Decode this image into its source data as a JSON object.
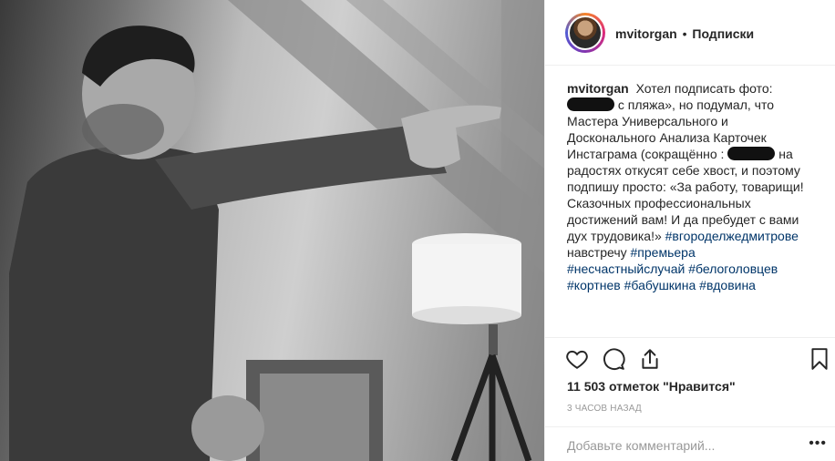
{
  "post": {
    "username": "mvitorgan",
    "separator": "•",
    "follow_label": "Подписки",
    "caption_part1": "Хотел подписать фото:",
    "caption_part2": "с пляжа», но подумал, что Мастера Универсального и Досконального Анализа Карточек Инстаграма (сокращённо :",
    "caption_part3": "на радостях откусят себе хвост, и поэтому подпишу просто: «За работу, товарищи! Сказочных профессиональных достижений вам! И да пребудет с вами дух трудовика!»",
    "caption_part4": "навстречу",
    "hashtags": [
      "#вгороделжедмитрове",
      "#премьера",
      "#несчастныйслучай",
      "#белоголовцев",
      "#кортнев",
      "#бабушкина",
      "#вдовина"
    ],
    "likes": "11 503 отметок \"Нравится\"",
    "timestamp": "3 часов назад",
    "comment_placeholder": "Добавьте комментарий...",
    "more_dots": "•••"
  },
  "icons": {
    "like": "heart-icon",
    "comment": "comment-icon",
    "share": "share-icon",
    "save": "bookmark-icon"
  }
}
